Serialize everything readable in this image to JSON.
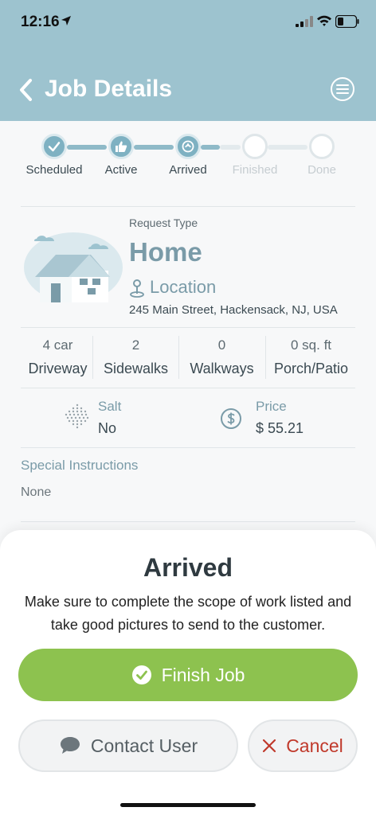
{
  "status_bar": {
    "time": "12:16"
  },
  "header": {
    "title": "Job Details"
  },
  "progress": {
    "steps": [
      {
        "label": "Scheduled",
        "state": "complete",
        "icon": "check-icon"
      },
      {
        "label": "Active",
        "state": "complete",
        "icon": "thumbs-up-icon"
      },
      {
        "label": "Arrived",
        "state": "complete",
        "icon": "arrived-icon"
      },
      {
        "label": "Finished",
        "state": "pending"
      },
      {
        "label": "Done",
        "state": "pending"
      }
    ]
  },
  "request": {
    "type_label": "Request Type",
    "type": "Home",
    "location_label": "Location",
    "address": "245 Main Street, Hackensack, NJ, USA"
  },
  "stats": [
    {
      "value": "4 car",
      "label": "Driveway"
    },
    {
      "value": "2",
      "label": "Sidewalks"
    },
    {
      "value": "0",
      "label": "Walkways"
    },
    {
      "value": "0 sq. ft",
      "label": "Porch/Patio"
    }
  ],
  "salt": {
    "label": "Salt",
    "value": "No"
  },
  "price": {
    "label": "Price",
    "value": "$ 55.21"
  },
  "special_instructions": {
    "title": "Special Instructions",
    "value": "None"
  },
  "sheet": {
    "title": "Arrived",
    "message": "Make sure to complete the scope of work listed and take good pictures to send to the customer.",
    "finish_label": "Finish Job",
    "contact_label": "Contact User",
    "cancel_label": "Cancel"
  },
  "colors": {
    "header": "#9dc3cf",
    "accent": "#7a9ba8",
    "finish": "#8dc24f",
    "cancel": "#c0392b"
  }
}
